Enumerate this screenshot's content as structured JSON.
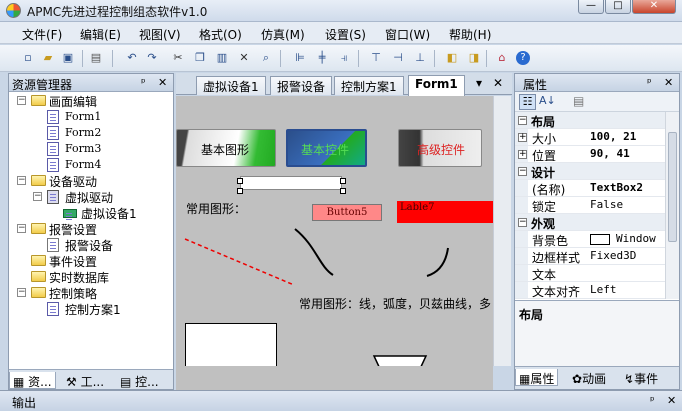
{
  "window": {
    "title": "APMC先进过程控制组态软件v1.0"
  },
  "menu": [
    "文件(F)",
    "编辑(E)",
    "视图(V)",
    "格式(O)",
    "仿真(M)",
    "设置(S)",
    "窗口(W)",
    "帮助(H)"
  ],
  "toolbar_icons": [
    "new-icon",
    "open-icon",
    "save-icon",
    "save-all-icon",
    "print-icon",
    "undo-icon",
    "redo-icon",
    "cut-icon",
    "copy-icon",
    "paste-icon",
    "delete-icon",
    "align-left-icon",
    "align-center-icon",
    "align-right-icon",
    "align-top-icon",
    "align-middle-icon",
    "align-bottom-icon",
    "bring-front-icon",
    "send-back-icon",
    "home-icon",
    "help-icon"
  ],
  "explorer": {
    "title": "资源管理器",
    "pin": "ᵖ",
    "close": "✕",
    "tree": [
      {
        "label": "画面编辑",
        "level": 0,
        "type": "folder",
        "exp": "−"
      },
      {
        "label": "Form1",
        "level": 1,
        "type": "doc"
      },
      {
        "label": "Form2",
        "level": 1,
        "type": "doc"
      },
      {
        "label": "Form3",
        "level": 1,
        "type": "doc"
      },
      {
        "label": "Form4",
        "level": 1,
        "type": "doc"
      },
      {
        "label": "设备驱动",
        "level": 0,
        "type": "folder",
        "exp": "−"
      },
      {
        "label": "虚拟驱动",
        "level": 1,
        "type": "device",
        "exp": "−"
      },
      {
        "label": "虚拟设备1",
        "level": 2,
        "type": "card"
      },
      {
        "label": "报警设置",
        "level": 0,
        "type": "folder",
        "exp": "−"
      },
      {
        "label": "报警设备",
        "level": 1,
        "type": "info"
      },
      {
        "label": "事件设置",
        "level": 0,
        "type": "folder"
      },
      {
        "label": "实时数据库",
        "level": 0,
        "type": "folder"
      },
      {
        "label": "控制策略",
        "level": 0,
        "type": "folder",
        "exp": "−"
      },
      {
        "label": "控制方案1",
        "level": 1,
        "type": "doc"
      }
    ],
    "bottom_tabs": [
      "资...",
      "工...",
      "控..."
    ]
  },
  "doc_tabs": [
    "虚拟设备1",
    "报警设备",
    "控制方案1",
    "Form1"
  ],
  "doc_tab_controls": {
    "menu": "▾",
    "close": "✕"
  },
  "canvas": {
    "btn_basic": "基本图形",
    "btn_basic_ctrl": "基本控件",
    "btn_advanced": "高级控件",
    "label_common": "常用图形：",
    "button5": "Button5",
    "label7": "Lable7",
    "desc": "常用图形：线，弧度，贝兹曲线，多"
  },
  "properties": {
    "title": "属性",
    "rows": [
      {
        "kind": "cat",
        "key": "布局",
        "exp": "−"
      },
      {
        "kind": "prop",
        "key": "大小",
        "value": "100, 21",
        "exp": "+"
      },
      {
        "kind": "prop",
        "key": "位置",
        "value": "90, 41",
        "exp": "+"
      },
      {
        "kind": "cat",
        "key": "设计",
        "exp": "−"
      },
      {
        "kind": "prop",
        "key": "(名称)",
        "value": "TextBox2"
      },
      {
        "kind": "prop",
        "key": "锁定",
        "value": "False",
        "norm": true
      },
      {
        "kind": "cat",
        "key": "外观",
        "exp": "−"
      },
      {
        "kind": "prop",
        "key": "背景色",
        "value": "Window",
        "norm": true,
        "swatch": true
      },
      {
        "kind": "prop",
        "key": "边框样式",
        "value": "Fixed3D",
        "norm": true
      },
      {
        "kind": "prop",
        "key": "文本",
        "value": ""
      },
      {
        "kind": "prop",
        "key": "文本对齐",
        "value": "Left",
        "norm": true
      }
    ],
    "desc": "布局",
    "bottom_tabs": [
      "属性",
      "动画",
      "事件"
    ]
  },
  "output": {
    "title": "输出"
  }
}
